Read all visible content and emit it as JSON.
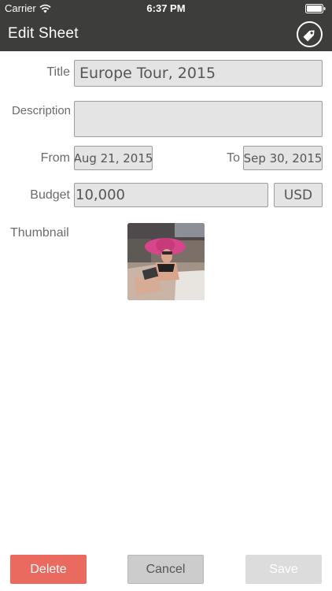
{
  "status_bar": {
    "carrier": "Carrier",
    "time": "6:37 PM"
  },
  "nav": {
    "title": "Edit Sheet",
    "tag_icon": "tag-icon"
  },
  "form": {
    "title_label": "Title",
    "title_value": "Europe Tour, 2015",
    "description_label": "Description",
    "description_value": "",
    "from_label": "From",
    "from_value": "Aug 21, 2015",
    "to_label": "To",
    "to_value": "Sep 30, 2015",
    "budget_label": "Budget",
    "budget_value": "10,000",
    "currency_value": "USD",
    "thumbnail_label": "Thumbnail"
  },
  "actions": {
    "delete_label": "Delete",
    "cancel_label": "Cancel",
    "save_label": "Save"
  },
  "colors": {
    "header_bg": "#3d3d3c",
    "delete_bg": "#ea6a60",
    "cancel_bg": "#cccccc",
    "save_bg": "#dcdcdc"
  }
}
